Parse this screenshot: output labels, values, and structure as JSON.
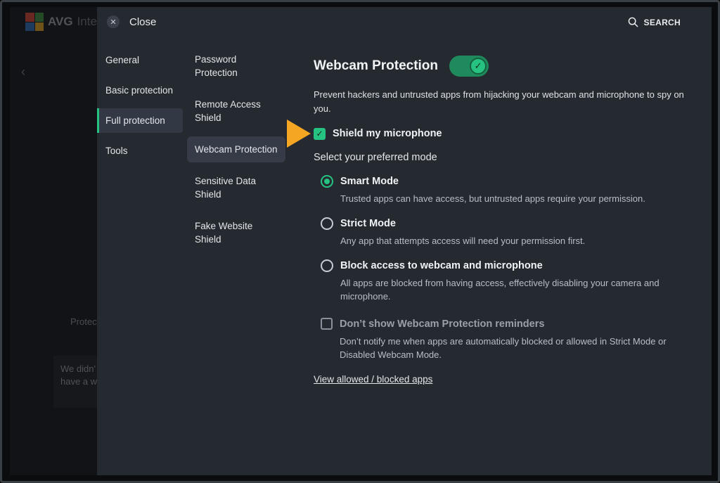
{
  "background_app": {
    "logo_text": "AVG",
    "logo_text_suffix": "Inte",
    "logo_colors": [
      "#d4422f",
      "#3b8d3e",
      "#2c6db8",
      "#e0a21b"
    ],
    "protection_text": "Protec",
    "card_text_line1": "We didn'",
    "card_text_line2": "have a w"
  },
  "dialog": {
    "close_label": "Close",
    "search_label": "SEARCH"
  },
  "nav_primary": [
    {
      "label": "General",
      "active": false
    },
    {
      "label": "Basic protection",
      "active": false
    },
    {
      "label": "Full protection",
      "active": true
    },
    {
      "label": "Tools",
      "active": false
    }
  ],
  "nav_secondary": [
    {
      "label": "Password Protection",
      "active": false
    },
    {
      "label": "Remote Access Shield",
      "active": false
    },
    {
      "label": "Webcam Protection",
      "active": true
    },
    {
      "label": "Sensitive Data Shield",
      "active": false
    },
    {
      "label": "Fake Website Shield",
      "active": false
    }
  ],
  "content": {
    "title": "Webcam Protection",
    "toggle_on": true,
    "description": "Prevent hackers and untrusted apps from hijacking your webcam and microphone to spy on you.",
    "shield_microphone": {
      "label": "Shield my microphone",
      "checked": true
    },
    "mode_prompt": "Select your preferred mode",
    "modes": [
      {
        "title": "Smart Mode",
        "description": "Trusted apps can have access, but untrusted apps require your permission.",
        "selected": true
      },
      {
        "title": "Strict Mode",
        "description": "Any app that attempts access will need your permission first.",
        "selected": false
      },
      {
        "title": "Block access to webcam and microphone",
        "description": "All apps are blocked from having access, effectively disabling your camera and microphone.",
        "selected": false
      }
    ],
    "reminders": {
      "title": "Don’t show Webcam Protection reminders",
      "description": "Don’t notify me when apps are automatically blocked or allowed in Strict Mode or Disabled Webcam Mode.",
      "checked": false
    },
    "link_label": "View allowed / blocked apps"
  },
  "colors": {
    "accent_green": "#26c281",
    "arrow_orange": "#f5a623",
    "dialog_bg": "#252a31"
  }
}
